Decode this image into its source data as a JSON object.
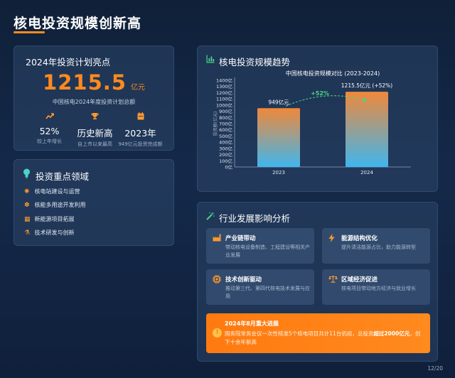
{
  "page": {
    "title": "核电投资规模创新高",
    "page_number": "12/20"
  },
  "plan_card": {
    "heading": "2024年投资计划亮点",
    "big_value": "1215.5",
    "big_unit": "亿元",
    "big_caption": "中国核电2024年度投资计划总额",
    "stats": [
      {
        "icon": "trend-up-icon",
        "value": "52%",
        "label": "较上年增长"
      },
      {
        "icon": "trophy-icon",
        "value": "历史新高",
        "label": "自上市以来最高"
      },
      {
        "icon": "calendar-icon",
        "value": "2023年",
        "label": "949亿元投资完成额"
      }
    ]
  },
  "focus_card": {
    "heading": "投资重点领域",
    "items": [
      {
        "icon": "gear-icon",
        "label": "核电站建设与运营"
      },
      {
        "icon": "atom-icon",
        "label": "核能多用途开发利用"
      },
      {
        "icon": "solar-panel-icon",
        "label": "新能源项目拓展"
      },
      {
        "icon": "flask-icon",
        "label": "技术研发与创新"
      }
    ]
  },
  "trend_card": {
    "heading": "核电投资规模趋势"
  },
  "chart_data": {
    "type": "bar",
    "title": "中国核电投资规模对比 (2023-2024)",
    "ylabel": "投资额(亿元)",
    "categories": [
      "2023",
      "2024"
    ],
    "values": [
      949,
      1215.5
    ],
    "data_labels": [
      "949亿元",
      "1215.5亿元 (+52%)"
    ],
    "growth_annotation": "+52%",
    "ylim": [
      0,
      1400
    ],
    "yticks": [
      "0亿",
      "100亿",
      "200亿",
      "300亿",
      "400亿",
      "500亿",
      "600亿",
      "700亿",
      "800亿",
      "900亿",
      "1000亿",
      "1100亿",
      "1200亿",
      "1300亿",
      "1400亿"
    ],
    "grid": false,
    "colors": {
      "bar_top": "#f0883a",
      "bar_bottom": "#3fb6ee",
      "annotation": "#4ad48a"
    }
  },
  "impact_card": {
    "heading": "行业发展影响分析",
    "boxes": [
      {
        "icon": "factory-icon",
        "title": "产业链带动",
        "desc": "带动核电设备制造、工程建设等相关产业发展"
      },
      {
        "icon": "bolt-icon",
        "title": "能源结构优化",
        "desc": "提升清洁能源占比，助力能源转型"
      },
      {
        "icon": "chip-icon",
        "title": "技术创新驱动",
        "desc": "推动第三代、第四代核电技术发展与应用"
      },
      {
        "icon": "scale-icon",
        "title": "区域经济促进",
        "desc": "核电项目带动地方经济与就业增长"
      }
    ],
    "highlight": {
      "icon": "info-icon",
      "title": "2024年8月重大进展",
      "desc_prefix": "国务院常务会议一次性核准5个核电项目共计11台机组，总投资",
      "desc_bold": "超过2000亿元",
      "desc_suffix": "，创下十余年新高"
    }
  },
  "colors": {
    "accent": "#ff8a1e",
    "background": "#14294a"
  }
}
